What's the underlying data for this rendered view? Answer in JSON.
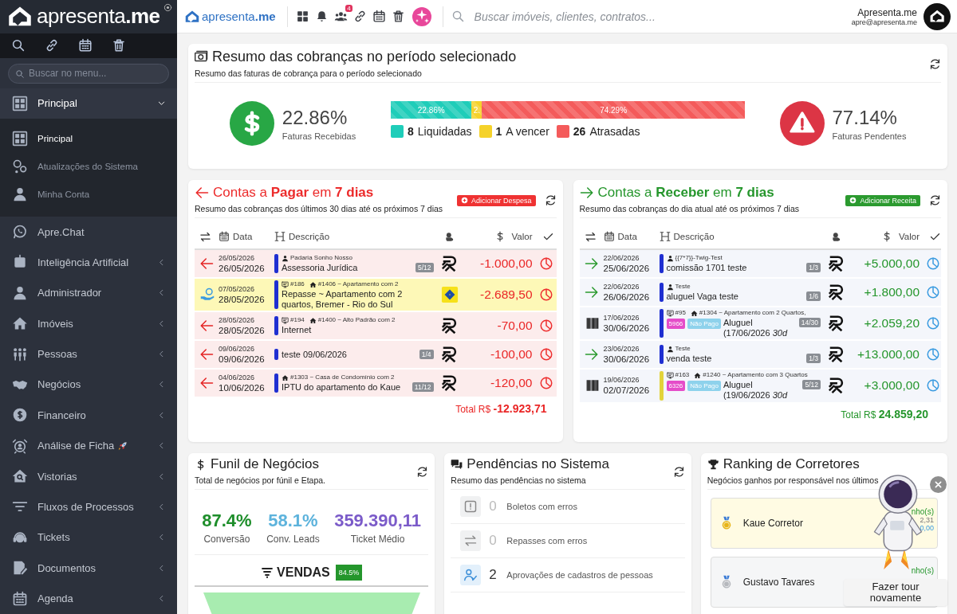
{
  "sidebar": {
    "logo": "apresenta**.me**",
    "search": {
      "placeholder": "Buscar no menu..."
    },
    "menu": [
      {
        "label": "Principal",
        "kind": "group",
        "expanded": true,
        "children": [
          {
            "label": "Principal",
            "selected": true
          },
          {
            "label": "Atualizações do Sistema",
            "selected": false
          },
          {
            "label": "Minha Conta",
            "selected": false
          }
        ]
      },
      {
        "label": "Apre.Chat",
        "kind": "link"
      },
      {
        "label": "Inteligência Artificial",
        "kind": "group",
        "expanded": false
      },
      {
        "label": "Administrador",
        "kind": "group",
        "expanded": false
      },
      {
        "label": "Imóveis",
        "kind": "group",
        "expanded": false
      },
      {
        "label": "Pessoas",
        "kind": "group",
        "expanded": false
      },
      {
        "label": "Negócios",
        "kind": "group",
        "expanded": false
      },
      {
        "label": "Financeiro",
        "kind": "group",
        "expanded": false
      },
      {
        "label": "Análise de Ficha",
        "kind": "group",
        "expanded": false
      },
      {
        "label": "Vistorias",
        "kind": "group",
        "expanded": false
      },
      {
        "label": "Fluxos de Processos",
        "kind": "group",
        "expanded": false
      },
      {
        "label": "Tickets",
        "kind": "group",
        "expanded": false
      },
      {
        "label": "Documentos",
        "kind": "group",
        "expanded": false
      },
      {
        "label": "Agenda",
        "kind": "group",
        "expanded": false
      }
    ]
  },
  "topbar": {
    "logo": "apresenta**.me**",
    "notification_count": "4",
    "search": {
      "placeholder": "Buscar imóveis, clientes, contratos..."
    },
    "user": {
      "name": "Apresenta.me",
      "email": "apre@apresenta.me"
    }
  },
  "summary": {
    "title": "Resumo das cobranças no período selecionado",
    "subtitle": "Resumo das faturas de cobrança para o período selecionado",
    "received": {
      "value": "22.86%",
      "label": "Faturas Recebidas"
    },
    "segments": [
      {
        "label": "22.86%",
        "level": 0.2286,
        "color": "#1fcdb9"
      },
      {
        "label": "2.",
        "level": 0.0286,
        "color": "#f5d22a"
      },
      {
        "label": "74.29%",
        "level": 0.7429,
        "color": "#f45b5b"
      }
    ],
    "legend": [
      {
        "count": "8",
        "label": "Liquidadas",
        "color": "#1fcdb9"
      },
      {
        "count": "1",
        "label": "A vencer",
        "color": "#f5d22a"
      },
      {
        "count": "26",
        "label": "Atrasadas",
        "color": "#f45b5b"
      }
    ],
    "pending": {
      "value": "77.14%",
      "label": "Faturas Pendentes"
    }
  },
  "payables": {
    "kind": "pay",
    "title": "Contas a **Pagar** em **7 dias**",
    "subtitle": "Resumo das cobranças dos últimos 30 dias até os próximos 7 dias",
    "button": "Adicionar Despesa",
    "columns": [
      "Data",
      "Descrição",
      "Valor"
    ],
    "rows": [
      {
        "kind": "arrow",
        "highlight": false,
        "date_top": "26/05/2026",
        "date": "26/05/2026",
        "color": "#1f2fd1",
        "meta": [
          {
            "kind": "person",
            "text": "Padaria Sonho Nosso"
          }
        ],
        "description": "Assessoria Jurídica",
        "installment": "5/12",
        "bank": {
          "kind": "r"
        },
        "value": "-1.000,00"
      },
      {
        "kind": "repasse",
        "highlight": true,
        "date_top": "07/05/2026",
        "date": "28/05/2026",
        "color": "#1f2fd1",
        "meta": [
          {
            "kind": "contract",
            "text": "#186"
          },
          {
            "kind": "property",
            "text": "#1406 ~ Apartamento com 2"
          }
        ],
        "description": "Repasse ~ Apartamento com 2 quartos, Bremer - Rio do Sul",
        "bank": {
          "kind": "bb"
        },
        "value": "-2.689,50"
      },
      {
        "kind": "arrow",
        "highlight": false,
        "date_top": "28/05/2026",
        "date": "28/05/2026",
        "color": "#1f2fd1",
        "meta": [
          {
            "kind": "contract",
            "text": "#194"
          },
          {
            "kind": "property",
            "text": "#1400 ~ Alto Padrão com 2"
          }
        ],
        "description": "Internet",
        "bank": {
          "kind": "r"
        },
        "value": "-70,00"
      },
      {
        "kind": "arrow",
        "highlight": false,
        "date_top": "09/06/2026",
        "date": "09/06/2026",
        "color": "#1f2fd1",
        "description": "teste 09/06/2026",
        "installment": "1/4",
        "bank": {
          "kind": "r"
        },
        "value": "-100,00"
      },
      {
        "kind": "arrow",
        "highlight": false,
        "date_top": "04/06/2026",
        "date": "10/06/2026",
        "color": "#1f2fd1",
        "meta": [
          {
            "kind": "property",
            "text": "#1303 ~ Casa de Condomínio com 2"
          }
        ],
        "description": "IPTU do apartamento do Kaue",
        "installment": "11/12",
        "bank": {
          "kind": "r"
        },
        "value": "-120,00"
      }
    ],
    "total": {
      "label": "Total R$",
      "value": "-12.923,71"
    }
  },
  "receivables": {
    "kind": "receive",
    "title": "Contas a **Receber** em **7 dias**",
    "subtitle": "Resumo das cobranças do dia atual até os próximos 7 dias",
    "button": "Adicionar Receita",
    "columns": [
      "Data",
      "Descrição",
      "Valor"
    ],
    "rows": [
      {
        "kind": "arrow",
        "highlight": false,
        "date_top": "22/06/2026",
        "date": "25/06/2026",
        "color": "#1f2fd1",
        "meta": [
          {
            "kind": "person",
            "text": "{{7*7}}-Twig-Test"
          }
        ],
        "description": "comissão 1701 teste",
        "installment": "1/3",
        "bank": {
          "kind": "r"
        },
        "value": "+5.000,00"
      },
      {
        "kind": "arrow",
        "highlight": false,
        "date_top": "22/06/2026",
        "date": "26/06/2026",
        "color": "#1f2fd1",
        "meta": [
          {
            "kind": "person",
            "text": "Teste"
          }
        ],
        "description": "aluguel Vaga teste",
        "installment": "1/6",
        "bank": {
          "kind": "r"
        },
        "value": "+1.800,00"
      },
      {
        "kind": "boleto",
        "highlight": false,
        "date_top": "17/06/2026",
        "date": "30/06/2026",
        "color": "#1f2fd1",
        "meta": [
          {
            "kind": "contract",
            "text": "#95"
          },
          {
            "kind": "property",
            "text": "#1304 ~ Apartamento com 2 Quartos,"
          }
        ],
        "tags": [
          {
            "text": "5966",
            "color": "#e54cc9"
          },
          {
            "text": "Não Pago",
            "color": "#8ed2ec"
          }
        ],
        "description": "Aluguel",
        "detail": "(17/06/2026 *30d*",
        "installment": "14/30",
        "bank": {
          "kind": "r"
        },
        "value": "+2.059,20"
      },
      {
        "kind": "arrow",
        "highlight": false,
        "date_top": "23/06/2026",
        "date": "30/06/2026",
        "color": "#1f2fd1",
        "meta": [
          {
            "kind": "person",
            "text": "Teste"
          }
        ],
        "description": "venda teste",
        "installment": "1/3",
        "bank": {
          "kind": "r"
        },
        "value": "+13.000,00"
      },
      {
        "kind": "boleto",
        "highlight": false,
        "date_top": "19/06/2026",
        "date": "02/07/2026",
        "color": "#e2d33a",
        "meta": [
          {
            "kind": "contract",
            "text": "#163"
          },
          {
            "kind": "property",
            "text": "#1240 ~ Apartamento com 3 Quartos"
          }
        ],
        "tags": [
          {
            "text": "6326",
            "color": "#e54cc9"
          },
          {
            "text": "Não Pago",
            "color": "#8ed2ec"
          }
        ],
        "description": "Aluguel",
        "detail": "(19/06/2026 *30d*",
        "installment": "5/12",
        "bank": {
          "kind": "r"
        },
        "value": "+3.000,00"
      }
    ],
    "total": {
      "label": "Total R$",
      "value": "24.859,20"
    }
  },
  "funnel": {
    "title": "Funil de Negócios",
    "subtitle": "Total de negócios por fúnil e Etapa.",
    "stats": [
      {
        "value": "87.4%",
        "label": "Conversão",
        "color": "#1e8e2b"
      },
      {
        "value": "58.1%",
        "label": "Conv. Leads",
        "color": "#5db3dc"
      },
      {
        "value": "359.390,11",
        "label": "Ticket Médio",
        "color": "#7b5bc9"
      }
    ],
    "stage": {
      "label": "VENDAS",
      "badge": "84.5%"
    }
  },
  "pending": {
    "title": "Pendências no Sistema",
    "subtitle": "Resumo das pendências no sistema",
    "items": [
      {
        "count": "0",
        "label": "Boletos com erros",
        "highlighted": false
      },
      {
        "count": "0",
        "label": "Repasses com erros",
        "highlighted": false
      },
      {
        "count": "2",
        "label": "Aprovações de cadastros de pessoas",
        "highlighted": true
      }
    ]
  },
  "ranking": {
    "title": "Ranking de Corretores",
    "subtitle": "Negócios ganhos por responsável nos últimos",
    "items": [
      {
        "kind": "gold",
        "name": "Kaue Corretor",
        "side": [
          "nho(s)",
          "2,31",
          "0,00"
        ]
      },
      {
        "kind": "silver",
        "name": "Gustavo Tavares",
        "side": [
          "nho(s)"
        ]
      }
    ]
  },
  "tour": {
    "button": "Fazer tour novamente"
  }
}
